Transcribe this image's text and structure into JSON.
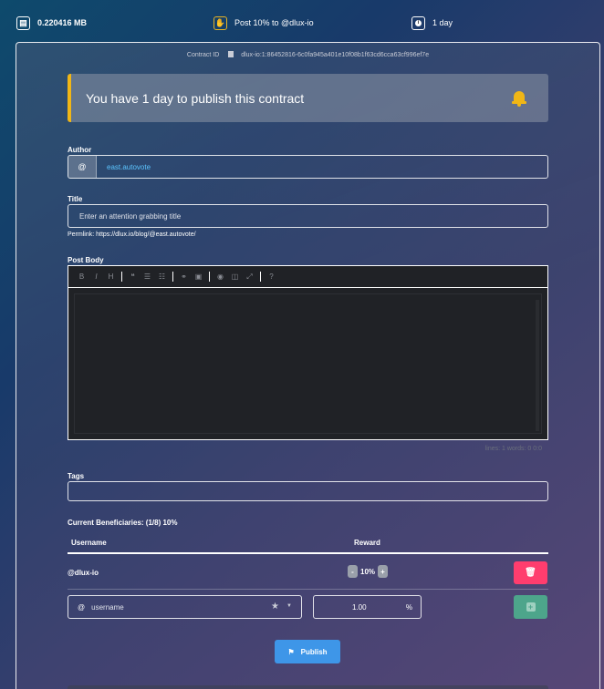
{
  "topbar": {
    "size": "0.220416 MB",
    "post": "Post 10% to @dlux-io",
    "time": "1 day"
  },
  "contract": {
    "label": "Contract ID",
    "id": "dlux-io:1:86452816-6c0fa945a401e10f08b1f63cd6cca63cf996ef7e"
  },
  "alert": {
    "text": "You have 1 day to publish this contract"
  },
  "author": {
    "label": "Author",
    "prefix": "@",
    "value": "east.autovote"
  },
  "title": {
    "label": "Title",
    "placeholder": "Enter an attention grabbing title"
  },
  "permlink": "Permlink: https://dlux.io/blog/@east.autovote/",
  "body": {
    "label": "Post Body",
    "toolbar": [
      "B",
      "I",
      "H",
      "❝",
      "☰",
      "☷",
      "⚭",
      "▣",
      "◉",
      "◫",
      "⤢",
      "?"
    ],
    "status": "lines: 1   words: 0   0:0"
  },
  "tags": {
    "label": "Tags"
  },
  "beneficiaries": {
    "title": "Current Beneficiaries: (1/8) 10%",
    "headers": [
      "Username",
      "Reward"
    ],
    "rows": [
      {
        "username": "@dlux-io",
        "reward": "10%"
      }
    ],
    "new_username_placeholder": "username",
    "new_reward": "1.00",
    "percent": "%"
  },
  "publish_label": "Publish",
  "colors": {
    "accent": "#3e96e8",
    "warning": "#f0b616",
    "danger": "#ff3d6e",
    "success": "#4da58b"
  }
}
